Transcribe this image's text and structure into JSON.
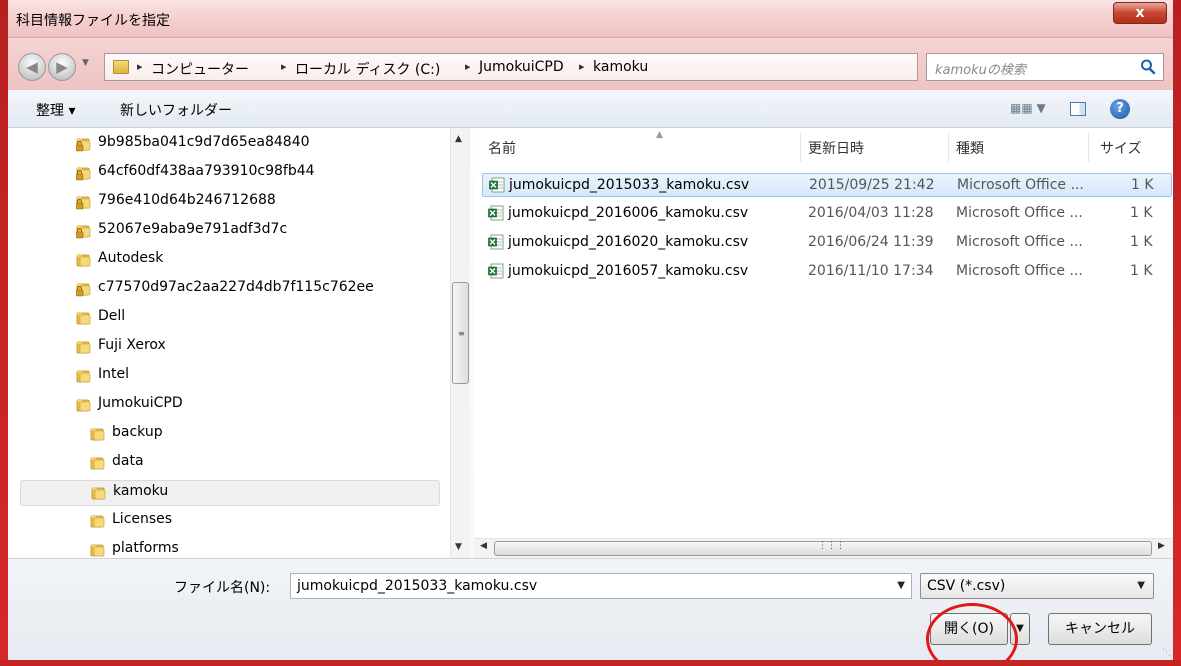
{
  "window": {
    "title": "科目情報ファイルを指定",
    "close_label": "x"
  },
  "address_bar": {
    "breadcrumbs": [
      "コンピューター",
      "ローカル ディスク (C:)",
      "JumokuiCPD",
      "kamoku"
    ],
    "separator": "▸"
  },
  "search": {
    "placeholder": "kamokuの検索"
  },
  "toolbar": {
    "organize_label": "整理 ▾",
    "new_folder_label": "新しいフォルダー"
  },
  "nav_tree": {
    "items": [
      {
        "label": "9b985ba041c9d7d65ea84840",
        "icon": "locked-folder-icon",
        "indent": 0
      },
      {
        "label": "64cf60df438aa793910c98fb44",
        "icon": "locked-folder-icon",
        "indent": 0
      },
      {
        "label": "796e410d64b246712688",
        "icon": "locked-folder-icon",
        "indent": 0
      },
      {
        "label": "52067e9aba9e791adf3d7c",
        "icon": "locked-folder-icon",
        "indent": 0
      },
      {
        "label": "Autodesk",
        "icon": "folder-icon",
        "indent": 0
      },
      {
        "label": "c77570d97ac2aa227d4db7f115c762ee",
        "icon": "locked-folder-icon",
        "indent": 0
      },
      {
        "label": "Dell",
        "icon": "folder-icon",
        "indent": 0
      },
      {
        "label": "Fuji Xerox",
        "icon": "folder-icon",
        "indent": 0
      },
      {
        "label": "Intel",
        "icon": "folder-icon",
        "indent": 0
      },
      {
        "label": "JumokuiCPD",
        "icon": "folder-icon",
        "indent": 0
      },
      {
        "label": "backup",
        "icon": "folder-icon",
        "indent": 1
      },
      {
        "label": "data",
        "icon": "folder-icon",
        "indent": 1
      },
      {
        "label": "kamoku",
        "icon": "folder-icon",
        "indent": 1,
        "selected": true
      },
      {
        "label": "Licenses",
        "icon": "folder-icon",
        "indent": 1
      },
      {
        "label": "platforms",
        "icon": "folder-icon",
        "indent": 1
      }
    ]
  },
  "file_list": {
    "columns": [
      "名前",
      "更新日時",
      "種類",
      "サイズ"
    ],
    "files": [
      {
        "name": "jumokuicpd_2015033_kamoku.csv",
        "modified": "2015/09/25 21:42",
        "type": "Microsoft Office ...",
        "size": "1 K",
        "selected": true
      },
      {
        "name": "jumokuicpd_2016006_kamoku.csv",
        "modified": "2016/04/03 11:28",
        "type": "Microsoft Office ...",
        "size": "1 K"
      },
      {
        "name": "jumokuicpd_2016020_kamoku.csv",
        "modified": "2016/06/24 11:39",
        "type": "Microsoft Office ...",
        "size": "1 K"
      },
      {
        "name": "jumokuicpd_2016057_kamoku.csv",
        "modified": "2016/11/10 17:34",
        "type": "Microsoft Office ...",
        "size": "1 K"
      }
    ]
  },
  "footer": {
    "filename_label": "ファイル名(N):",
    "filename_value": "jumokuicpd_2015033_kamoku.csv",
    "filetype_value": "CSV (*.csv)",
    "open_label": "開く(O)",
    "cancel_label": "キャンセル"
  },
  "colors": {
    "accent_red": "#e01818",
    "selection_blue": "#d6e8fb"
  }
}
